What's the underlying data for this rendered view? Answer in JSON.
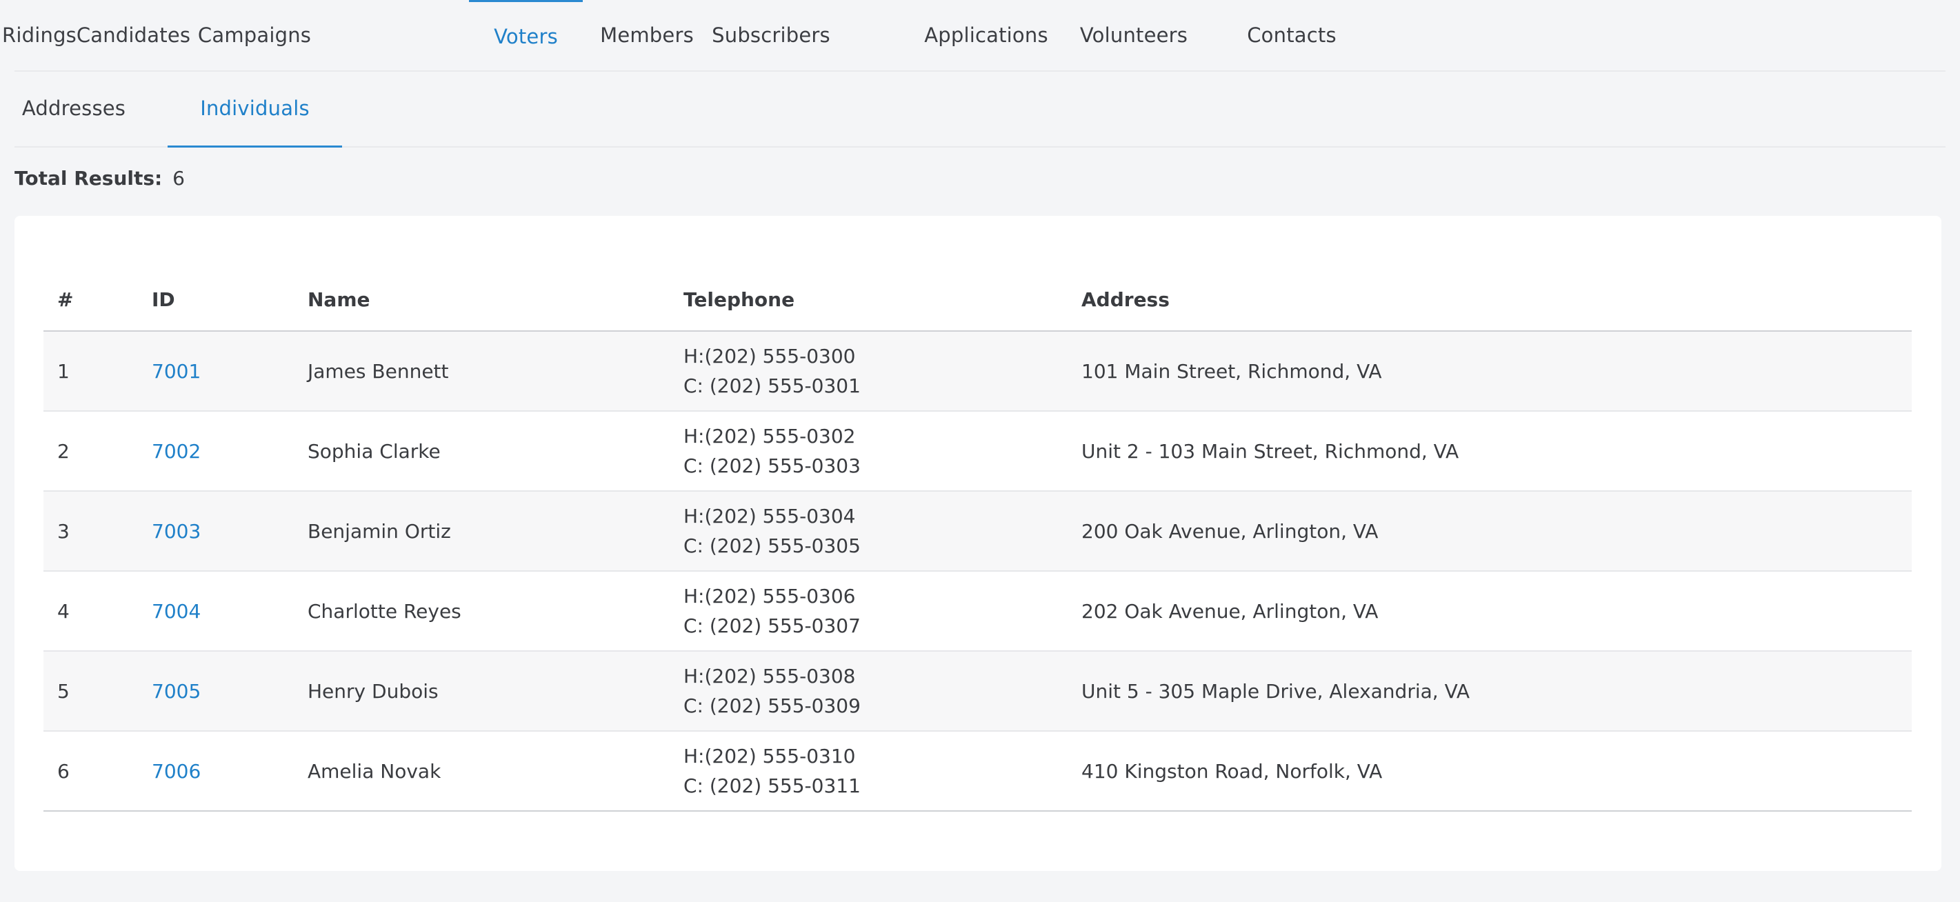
{
  "primary_tabs": [
    {
      "label": "Ridings",
      "active": false
    },
    {
      "label": "Candidates",
      "active": false
    },
    {
      "label": "Campaigns",
      "active": false
    },
    {
      "label": "Voters",
      "active": true
    },
    {
      "label": "Members",
      "active": false
    },
    {
      "label": "Subscribers",
      "active": false
    },
    {
      "label": "Applications",
      "active": false
    },
    {
      "label": "Volunteers",
      "active": false
    },
    {
      "label": "Contacts",
      "active": false
    }
  ],
  "secondary_tabs": [
    {
      "label": "Addresses",
      "active": false
    },
    {
      "label": "Individuals",
      "active": true
    }
  ],
  "summary": {
    "total_label": "Total Results:",
    "total_value": "6"
  },
  "table": {
    "headers": {
      "num": "#",
      "id": "ID",
      "name": "Name",
      "telephone": "Telephone",
      "address": "Address"
    },
    "rows": [
      {
        "num": "1",
        "id": "7001",
        "name": "James Bennett",
        "home": "H:(202) 555-0300",
        "cell": "C: (202) 555-0301",
        "address": "101 Main Street, Richmond, VA"
      },
      {
        "num": "2",
        "id": "7002",
        "name": "Sophia Clarke",
        "home": "H:(202) 555-0302",
        "cell": "C: (202) 555-0303",
        "address": "Unit 2 - 103 Main Street, Richmond, VA"
      },
      {
        "num": "3",
        "id": "7003",
        "name": "Benjamin Ortiz",
        "home": "H:(202) 555-0304",
        "cell": "C: (202) 555-0305",
        "address": "200 Oak Avenue, Arlington, VA"
      },
      {
        "num": "4",
        "id": "7004",
        "name": "Charlotte Reyes",
        "home": "H:(202) 555-0306",
        "cell": "C: (202) 555-0307",
        "address": "202 Oak Avenue, Arlington, VA"
      },
      {
        "num": "5",
        "id": "7005",
        "name": "Henry Dubois",
        "home": "H:(202) 555-0308",
        "cell": "C: (202) 555-0309",
        "address": "Unit 5 - 305 Maple Drive, Alexandria, VA"
      },
      {
        "num": "6",
        "id": "7006",
        "name": "Amelia Novak",
        "home": "H:(202) 555-0310",
        "cell": "C: (202) 555-0311",
        "address": "410 Kingston Road, Norfolk, VA"
      }
    ]
  },
  "colors": {
    "accent": "#1f80c9",
    "background": "#f4f5f7",
    "card": "#ffffff",
    "text": "#3a3c40"
  }
}
